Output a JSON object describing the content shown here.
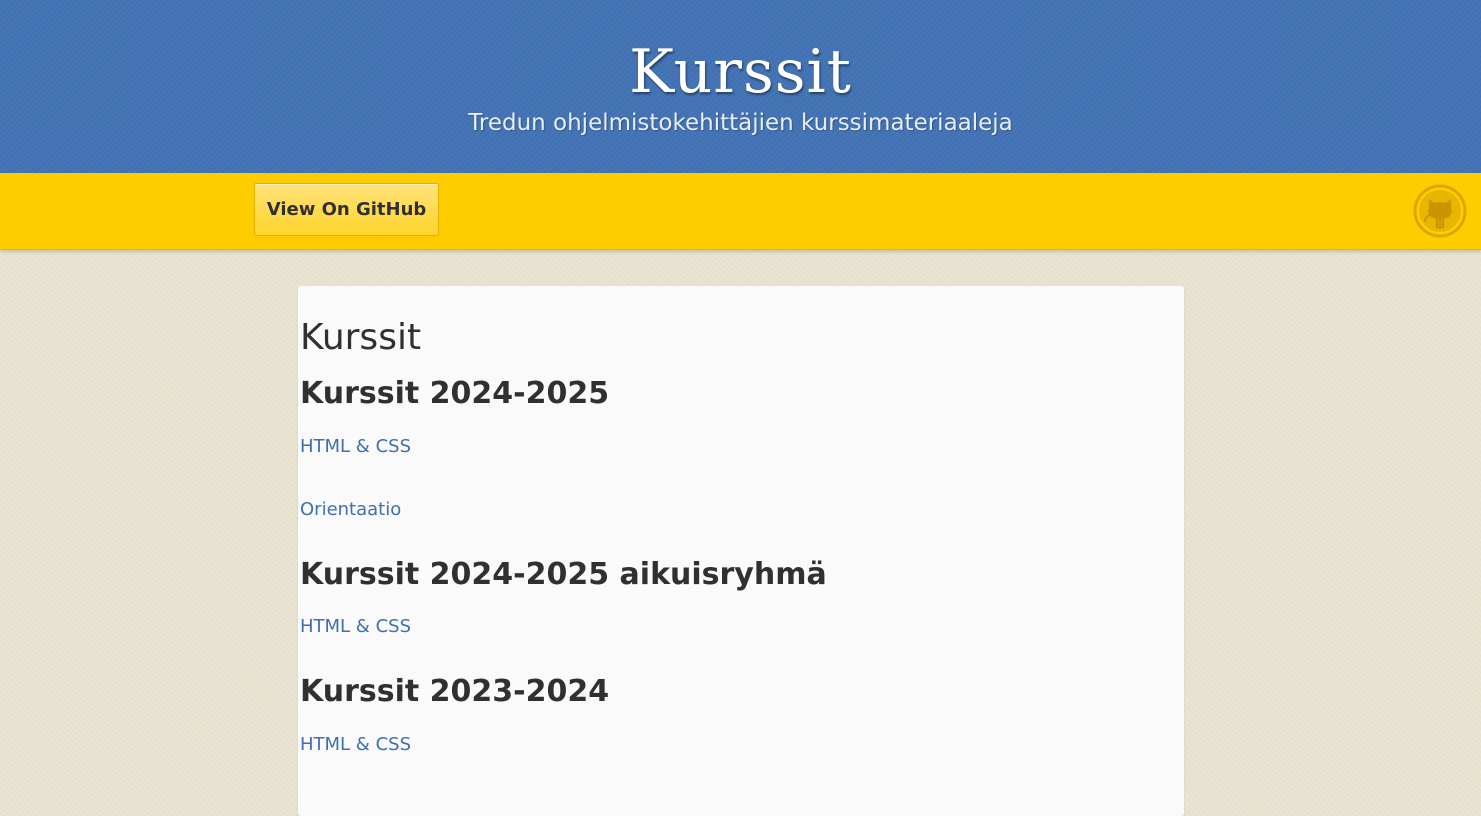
{
  "header": {
    "title": "Kurssit",
    "tagline": "Tredun ohjelmistokehittäjien kurssimateriaaleja"
  },
  "ribbon": {
    "github_button_label": "View On GitHub",
    "octocat_icon": "github-octocat-icon"
  },
  "main": {
    "page_heading": "Kurssit",
    "sections": [
      {
        "heading": "Kurssit 2024-2025",
        "links": [
          "HTML & CSS",
          "Orientaatio"
        ]
      },
      {
        "heading": "Kurssit 2024-2025 aikuisryhmä",
        "links": [
          "HTML & CSS"
        ]
      },
      {
        "heading": "Kurssit 2023-2024",
        "links": [
          "HTML & CSS"
        ]
      }
    ]
  },
  "colors": {
    "header_blue": "#4273b5",
    "ribbon_yellow": "#ffcc00",
    "link_blue": "#3d6fb1",
    "background_beige": "#eae4d1"
  }
}
